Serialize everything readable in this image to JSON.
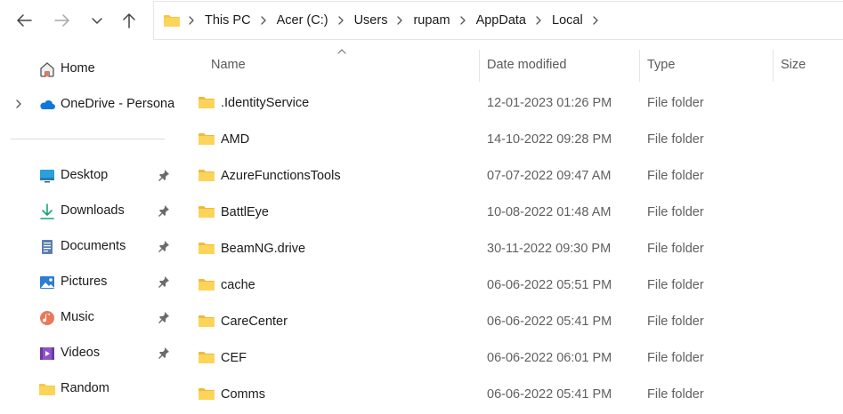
{
  "nav": {
    "back_icon": "arrow-left-icon",
    "forward_icon": "arrow-right-icon",
    "recent_icon": "chevron-down-icon",
    "up_icon": "arrow-up-icon"
  },
  "breadcrumb": [
    "This PC",
    "Acer (C:)",
    "Users",
    "rupam",
    "AppData",
    "Local"
  ],
  "sidebar": {
    "items": [
      {
        "label": "Home",
        "icon": "home-icon",
        "pinned": false
      },
      {
        "label": "OneDrive - Persona",
        "icon": "onedrive-cloud-icon",
        "pinned": false
      },
      {
        "label": "Desktop",
        "icon": "desktop-icon",
        "pinned": true
      },
      {
        "label": "Downloads",
        "icon": "download-icon",
        "pinned": true
      },
      {
        "label": "Documents",
        "icon": "documents-icon",
        "pinned": true
      },
      {
        "label": "Pictures",
        "icon": "pictures-icon",
        "pinned": true
      },
      {
        "label": "Music",
        "icon": "music-icon",
        "pinned": true
      },
      {
        "label": "Videos",
        "icon": "videos-icon",
        "pinned": true
      },
      {
        "label": "Random",
        "icon": "folder-icon",
        "pinned": false
      }
    ]
  },
  "columns": {
    "name": "Name",
    "date": "Date modified",
    "type": "Type",
    "size": "Size"
  },
  "files": [
    {
      "name": ".IdentityService",
      "date": "12-01-2023 01:26 PM",
      "type": "File folder",
      "size": ""
    },
    {
      "name": "AMD",
      "date": "14-10-2022 09:28 PM",
      "type": "File folder",
      "size": ""
    },
    {
      "name": "AzureFunctionsTools",
      "date": "07-07-2022 09:47 AM",
      "type": "File folder",
      "size": ""
    },
    {
      "name": "BattlEye",
      "date": "10-08-2022 01:48 AM",
      "type": "File folder",
      "size": ""
    },
    {
      "name": "BeamNG.drive",
      "date": "30-11-2022 09:30 PM",
      "type": "File folder",
      "size": ""
    },
    {
      "name": "cache",
      "date": "06-06-2022 05:51 PM",
      "type": "File folder",
      "size": ""
    },
    {
      "name": "CareCenter",
      "date": "06-06-2022 05:41 PM",
      "type": "File folder",
      "size": ""
    },
    {
      "name": "CEF",
      "date": "06-06-2022 06:01 PM",
      "type": "File folder",
      "size": ""
    },
    {
      "name": "Comms",
      "date": "06-06-2022 05:41 PM",
      "type": "File folder",
      "size": ""
    }
  ],
  "colors": {
    "folder": "#f5c746",
    "folder_dark": "#e2a52a",
    "accent": "#0067c0",
    "text": "#1b1b1b",
    "muted": "#606060"
  }
}
